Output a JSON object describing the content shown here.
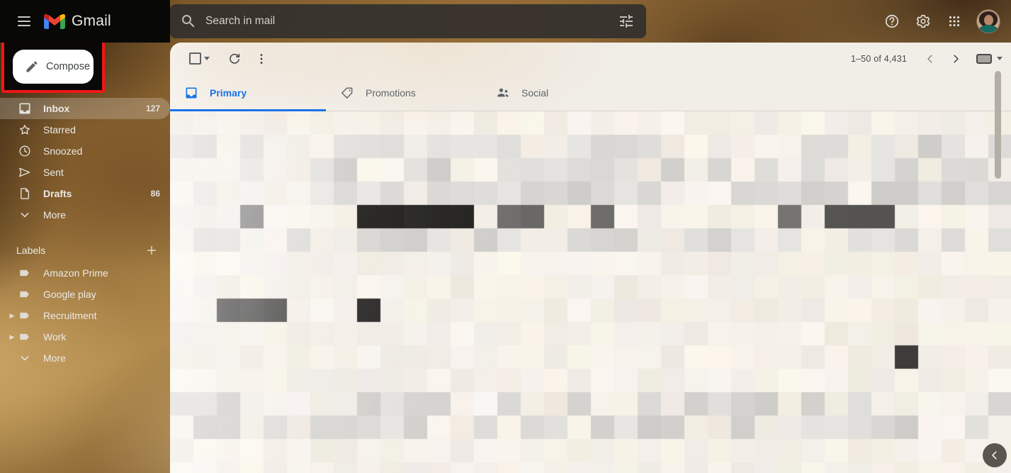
{
  "app": {
    "brand": "Gmail",
    "menu_icon": "hamburger-menu-icon",
    "logo_icon": "gmail-logo-icon"
  },
  "search": {
    "placeholder": "Search in mail",
    "value": "",
    "search_icon": "search-icon",
    "filter_icon": "tune-filter-icon"
  },
  "header_actions": {
    "help": "help-circle-icon",
    "settings": "gear-icon",
    "apps": "apps-grid-icon",
    "avatar": "user-avatar"
  },
  "sidebar": {
    "compose": {
      "label": "Compose",
      "icon": "pencil-icon",
      "highlighted": true,
      "highlight_color": "#f01616"
    },
    "nav": [
      {
        "label": "Inbox",
        "icon": "inbox-icon",
        "count": "127",
        "active": true,
        "bold": true
      },
      {
        "label": "Starred",
        "icon": "star-icon",
        "count": "",
        "active": false,
        "bold": false
      },
      {
        "label": "Snoozed",
        "icon": "clock-icon",
        "count": "",
        "active": false,
        "bold": false
      },
      {
        "label": "Sent",
        "icon": "send-icon",
        "count": "",
        "active": false,
        "bold": false
      },
      {
        "label": "Drafts",
        "icon": "draft-icon",
        "count": "86",
        "active": false,
        "bold": true
      },
      {
        "label": "More",
        "icon": "chevron-down-icon",
        "count": "",
        "active": false,
        "bold": false
      }
    ],
    "labels_header": {
      "title": "Labels",
      "add_icon": "plus-icon"
    },
    "labels": [
      {
        "label": "Amazon Prime",
        "icon": "label-tag-icon",
        "expandable": false
      },
      {
        "label": "Google play",
        "icon": "label-tag-icon",
        "expandable": false
      },
      {
        "label": "Recruitment",
        "icon": "label-tag-icon",
        "expandable": true
      },
      {
        "label": "Work",
        "icon": "label-tag-icon",
        "expandable": true
      }
    ],
    "labels_more": {
      "label": "More",
      "icon": "chevron-down-icon"
    }
  },
  "toolbar": {
    "select_all": {
      "name": "select-all-checkbox",
      "dropdown": "chevron-down-icon"
    },
    "refresh": "refresh-icon",
    "more_options": "more-vertical-icon",
    "pager_text": "1–50 of 4,431",
    "prev": "chevron-left-icon",
    "next": "chevron-right-icon",
    "input_tools": "keyboard-input-tools-icon",
    "input_tools_dropdown": "chevron-down-icon"
  },
  "tabs": [
    {
      "label": "Primary",
      "icon": "inbox-tab-icon",
      "active": true
    },
    {
      "label": "Promotions",
      "icon": "tag-tab-icon",
      "active": false
    },
    {
      "label": "Social",
      "icon": "people-tab-icon",
      "active": false
    }
  ],
  "message_list": {
    "state": "pixelated-redacted",
    "description": "Email list content is mosaic-blurred for privacy"
  },
  "side_panel_toggle": {
    "icon": "chevron-left-icon"
  },
  "colors": {
    "accent_blue": "#1a73e8",
    "highlight_red": "#f01616",
    "panel_bg": "#f1ede7",
    "topbar_left_bg": "#080807"
  }
}
